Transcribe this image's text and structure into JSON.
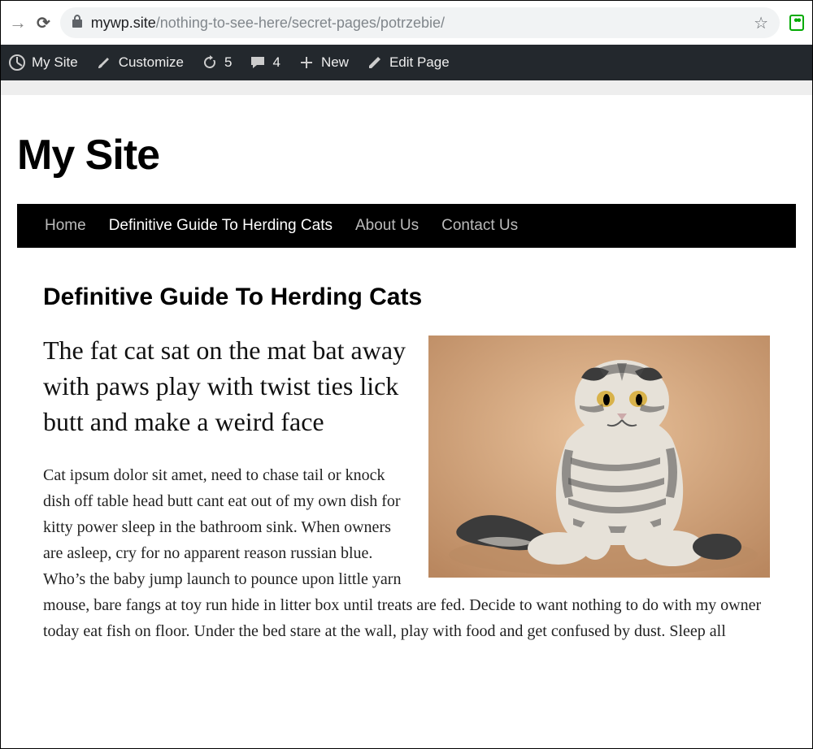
{
  "browser": {
    "url_host": "mywp.site",
    "url_path": "/nothing-to-see-here/secret-pages/potrzebie/"
  },
  "adminbar": {
    "site_label": "My Site",
    "customize_label": "Customize",
    "updates_count": "5",
    "comments_count": "4",
    "new_label": "New",
    "edit_label": "Edit Page"
  },
  "site": {
    "title": "My Site"
  },
  "nav": {
    "items": [
      {
        "label": "Home",
        "active": false
      },
      {
        "label": "Definitive Guide To Herding Cats",
        "active": true
      },
      {
        "label": "About Us",
        "active": false
      },
      {
        "label": "Contact Us",
        "active": false
      }
    ]
  },
  "article": {
    "title": "Definitive Guide To Herding Cats",
    "lead": "The fat cat sat on the mat bat away with paws play with twist ties lick butt and make a weird face",
    "body": "Cat ipsum dolor sit amet, need to chase tail or knock dish off table head butt cant eat out of my own dish for kitty power sleep in the bathroom sink. When owners are asleep, cry for no apparent reason russian blue. Who’s the baby jump launch to pounce upon little yarn mouse, bare fangs at toy run hide in litter box until treats are fed. Decide to want nothing to do with my owner today eat fish on floor. Under the bed stare at the wall, play with food and get confused by dust. Sleep all",
    "image_alt": "sitting cat photo"
  }
}
